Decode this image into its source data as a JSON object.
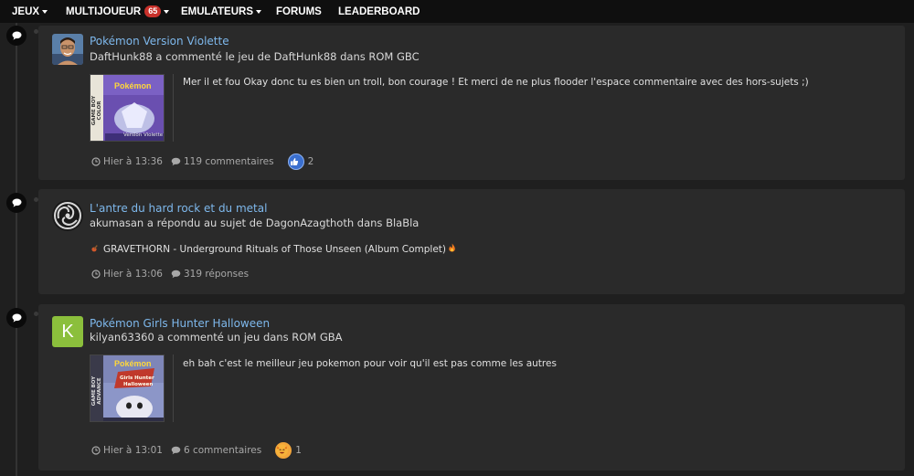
{
  "nav": {
    "items": [
      {
        "label": "JEUX",
        "caret": true
      },
      {
        "label": "MULTIJOUEUR",
        "badge": "65",
        "caret": true
      },
      {
        "label": "EMULATEURS",
        "caret": true
      },
      {
        "label": "FORUMS"
      },
      {
        "label": "LEADERBOARD"
      }
    ]
  },
  "activities": [
    {
      "title": "Pokémon Version Violette",
      "meta": "DaftHunk88 a commenté le jeu de DaftHunk88 dans ROM GBC",
      "comment": "Mer il et fou Okay donc tu es bien un troll, bon courage ! Et merci de ne plus flooder l'espace commentaire avec des hors-sujets ;)",
      "time": "Hier à 13:36",
      "count_label": "119 commentaires",
      "reaction_count": "2",
      "cover_lines": [
        "GAME BOY COLOR",
        "Pokémon",
        "Version Violette"
      ]
    },
    {
      "title": "L'antre du hard rock et du metal",
      "meta": "akumasan a répondu au sujet de DagonAzagthoth dans BlaBla",
      "comment": "GRAVETHORN - Underground Rituals of Those Unseen (Album Complet)",
      "time": "Hier à 13:06",
      "count_label": "319 réponses"
    },
    {
      "title": "Pokémon Girls Hunter Halloween",
      "meta": "kilyan63360 a commenté un jeu dans ROM GBA",
      "comment": "eh bah c'est le meilleur jeu pokemon pour voir qu'il est pas comme les autres",
      "time": "Hier à 13:01",
      "count_label": "6 commentaires",
      "reaction_count": "1",
      "avatar_letter": "K",
      "cover_lines": [
        "GAME BOY ADVANCE",
        "Pokémon",
        "Girls Hunter",
        "Halloween"
      ]
    }
  ],
  "colors": {
    "link": "#7eb8ec",
    "card_bg": "#2a2a2a",
    "page_bg": "#1f1f1f",
    "nav_bg": "#0f0f0f",
    "badge": "#c8312b",
    "avatar_k": "#8bbf3c"
  },
  "icons": [
    "comment-bubble-icon",
    "clock-icon",
    "comment-icon",
    "thumbs-up-icon",
    "haha-reaction-icon",
    "caret-down-icon",
    "fire-icon",
    "guitar-emoji-icon"
  ]
}
